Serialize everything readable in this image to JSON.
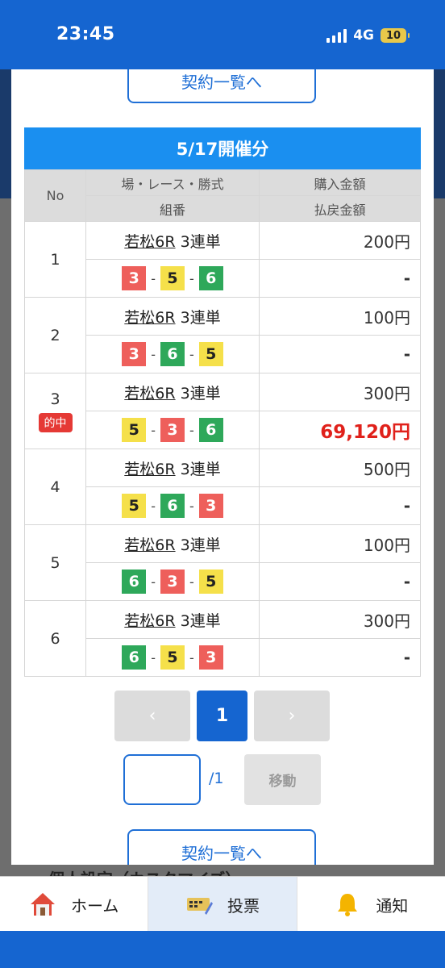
{
  "status": {
    "time": "23:45",
    "network": "4G",
    "battery": "10"
  },
  "modal": {
    "back_label": "契約一覧へ",
    "session_title": "5/17開催分",
    "headers": {
      "no": "No",
      "race": "場・レース・勝式",
      "combo": "組番",
      "purchase": "購入金額",
      "payout": "払戻金額"
    },
    "rows": [
      {
        "no": "1",
        "venue": "若松6R",
        "bet_type": "3連単",
        "combo": [
          "3",
          "5",
          "6"
        ],
        "purchase": "200円",
        "payout": "-",
        "hit": false
      },
      {
        "no": "2",
        "venue": "若松6R",
        "bet_type": "3連単",
        "combo": [
          "3",
          "6",
          "5"
        ],
        "purchase": "100円",
        "payout": "-",
        "hit": false
      },
      {
        "no": "3",
        "venue": "若松6R",
        "bet_type": "3連単",
        "combo": [
          "5",
          "3",
          "6"
        ],
        "purchase": "300円",
        "payout": "69,120円",
        "hit": true,
        "hit_label": "的中"
      },
      {
        "no": "4",
        "venue": "若松6R",
        "bet_type": "3連単",
        "combo": [
          "5",
          "6",
          "3"
        ],
        "purchase": "500円",
        "payout": "-",
        "hit": false
      },
      {
        "no": "5",
        "venue": "若松6R",
        "bet_type": "3連単",
        "combo": [
          "6",
          "3",
          "5"
        ],
        "purchase": "100円",
        "payout": "-",
        "hit": false
      },
      {
        "no": "6",
        "venue": "若松6R",
        "bet_type": "3連単",
        "combo": [
          "6",
          "5",
          "3"
        ],
        "purchase": "300円",
        "payout": "-",
        "hit": false
      }
    ],
    "pagination": {
      "prev": "‹",
      "current": "1",
      "next": "›",
      "total": "/1",
      "move_label": "移動",
      "input_value": ""
    }
  },
  "background_text": "個人設定（カスタマイズ）",
  "tabs": [
    {
      "label": "ホーム",
      "icon": "home-icon"
    },
    {
      "label": "投票",
      "icon": "ticket-pencil-icon",
      "active": true
    },
    {
      "label": "通知",
      "icon": "bell-icon"
    }
  ],
  "colors": {
    "brand": "#1565d0",
    "header": "#1a8ff0",
    "hit": "#e0211b",
    "boat3": "#ee5f5b",
    "boat5": "#f5e04a",
    "boat6": "#2ea85a"
  }
}
